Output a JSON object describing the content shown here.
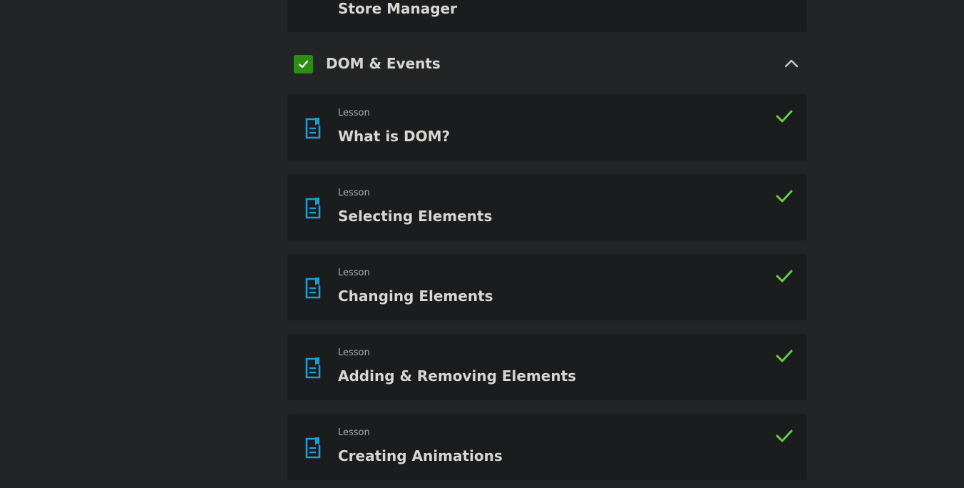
{
  "previous_item": {
    "title": "Store Manager",
    "icon": "project-icon",
    "icon_color": "#f0a32c"
  },
  "section": {
    "title": "DOM & Events",
    "completed": true,
    "expanded": true,
    "check_color": "#2f8d16"
  },
  "lessons": [
    {
      "kind": "Lesson",
      "title": "What is DOM?",
      "completed": true
    },
    {
      "kind": "Lesson",
      "title": "Selecting Elements",
      "completed": true
    },
    {
      "kind": "Lesson",
      "title": "Changing Elements",
      "completed": true
    },
    {
      "kind": "Lesson",
      "title": "Adding & Removing Elements",
      "completed": true
    },
    {
      "kind": "Lesson",
      "title": "Creating Animations",
      "completed": true
    }
  ],
  "colors": {
    "background": "#222426",
    "card": "#1b1c1e",
    "lesson_icon": "#1e9bd7",
    "completed_check": "#5fd23c"
  }
}
